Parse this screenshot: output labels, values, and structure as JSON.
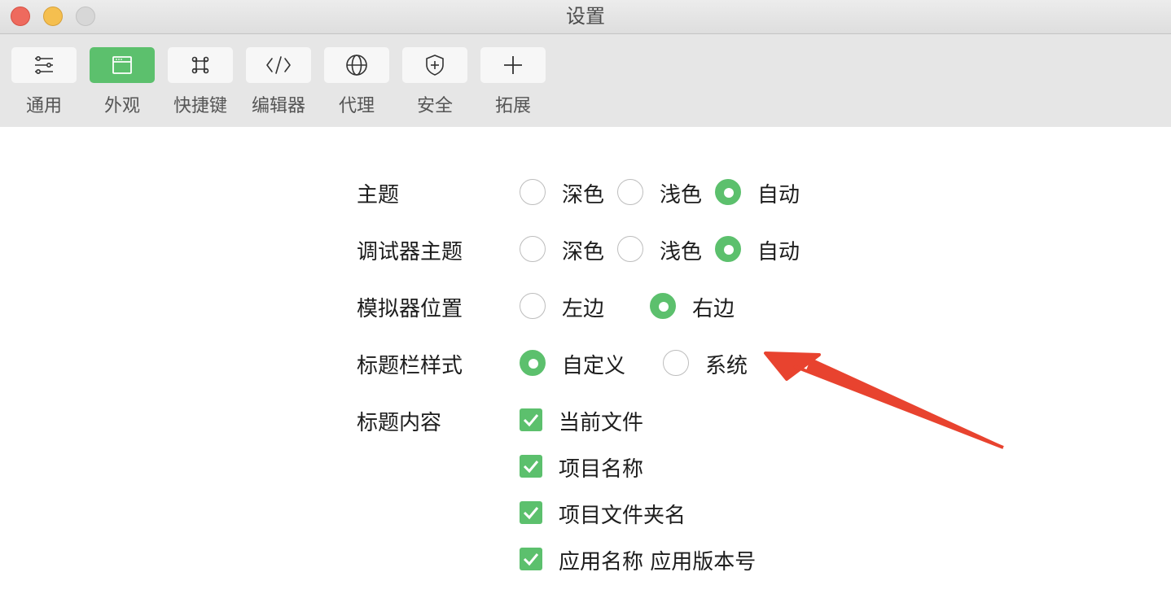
{
  "window": {
    "title": "设置"
  },
  "toolbar": {
    "tabs": [
      {
        "label": "通用",
        "icon": "sliders-icon"
      },
      {
        "label": "外观",
        "icon": "window-icon",
        "active": true
      },
      {
        "label": "快捷键",
        "icon": "command-key-icon"
      },
      {
        "label": "编辑器",
        "icon": "code-icon"
      },
      {
        "label": "代理",
        "icon": "globe-icon"
      },
      {
        "label": "安全",
        "icon": "shield-icon"
      },
      {
        "label": "拓展",
        "icon": "plus-icon"
      }
    ],
    "accent_color": "#5cc06d"
  },
  "settings": {
    "theme": {
      "label": "主题",
      "options": [
        "深色",
        "浅色",
        "自动"
      ],
      "selected": "自动"
    },
    "debugger_theme": {
      "label": "调试器主题",
      "options": [
        "深色",
        "浅色",
        "自动"
      ],
      "selected": "自动"
    },
    "simulator_position": {
      "label": "模拟器位置",
      "options": [
        "左边",
        "右边"
      ],
      "selected": "右边"
    },
    "titlebar_style": {
      "label": "标题栏样式",
      "options": [
        "自定义",
        "系统"
      ],
      "selected": "自定义"
    },
    "title_content": {
      "label": "标题内容",
      "items": [
        {
          "label": "当前文件",
          "checked": true
        },
        {
          "label": "项目名称",
          "checked": true
        },
        {
          "label": "项目文件夹名",
          "checked": true
        },
        {
          "label": "应用名称 应用版本号",
          "checked": true
        }
      ]
    }
  },
  "annotation": {
    "arrow_color": "#e8432f"
  }
}
